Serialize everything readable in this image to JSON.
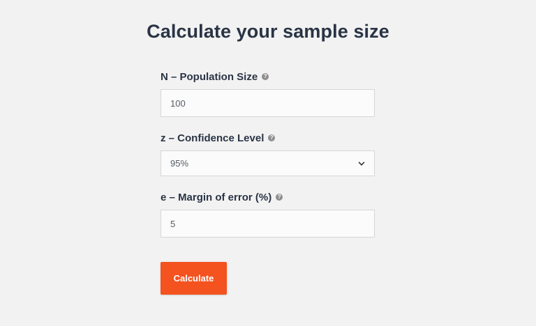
{
  "page": {
    "title": "Calculate your sample size"
  },
  "form": {
    "population": {
      "label": "N – Population Size",
      "help_icon": "question-circle-icon",
      "value": "100"
    },
    "confidence": {
      "label": "z – Confidence Level",
      "help_icon": "question-circle-icon",
      "selected": "95%"
    },
    "margin": {
      "label": "e – Margin of error (%)",
      "help_icon": "question-circle-icon",
      "value": "5"
    },
    "submit_label": "Calculate"
  },
  "colors": {
    "background": "#f2f2f2",
    "title": "#2a3445",
    "button": "#f4521f"
  }
}
